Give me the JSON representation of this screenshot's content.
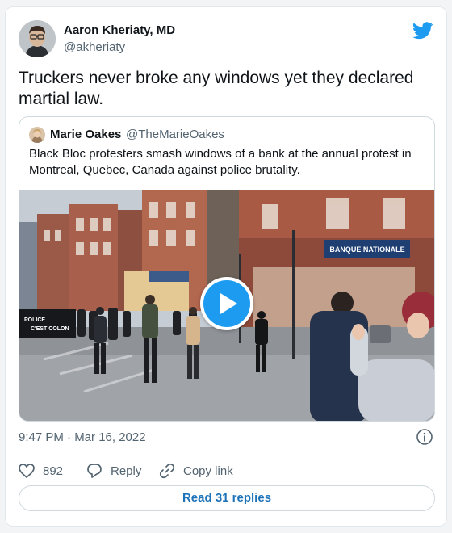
{
  "author": {
    "name": "Aaron Kheriaty, MD",
    "handle": "@akheriaty"
  },
  "tweet": {
    "text": "Truckers never broke any windows yet they declared martial law."
  },
  "quote": {
    "name": "Marie Oakes",
    "handle": "@TheMarieOakes",
    "text": "Black Bloc protesters smash windows of a bank at the annual protest in Montreal, Quebec, Canada against police brutality.",
    "video": {
      "bank_sign": "BANQUE NATIONALE",
      "banner_line1": "POLICE",
      "banner_line2": "C'EST COLON"
    }
  },
  "meta": {
    "timestamp": "9:47 PM · Mar 16, 2022"
  },
  "actions": {
    "likes": "892",
    "reply_label": "Reply",
    "copy_label": "Copy link"
  },
  "replies_button": "Read 31 replies",
  "colors": {
    "brand": "#1d9bf0",
    "text": "#0f1419",
    "muted": "#536471"
  },
  "icons": [
    "twitter-bird-icon",
    "play-icon",
    "info-icon",
    "heart-icon",
    "reply-icon",
    "link-icon"
  ]
}
